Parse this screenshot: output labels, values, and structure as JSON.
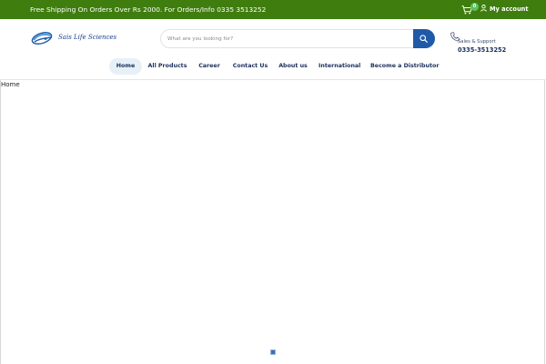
{
  "topbar": {
    "promo_text": "Free Shipping On Orders Over Rs 2000. For Orders/Info 0335 3513252",
    "cart_count": "0",
    "account_label": "My account",
    "background_color": "#3f7d0f"
  },
  "logo": {
    "text": "Sais Life Sciences"
  },
  "search": {
    "placeholder": "What are you looking for?",
    "value": "",
    "button_color": "#1f5aa8"
  },
  "support": {
    "label": "Sales & Support",
    "phone": "0335-3513252"
  },
  "nav": {
    "items": [
      {
        "label": "Home",
        "active": true
      },
      {
        "label": "All Products",
        "active": false
      },
      {
        "label": "Career",
        "active": false
      },
      {
        "label": "Contact Us",
        "active": false
      },
      {
        "label": "About us",
        "active": false
      },
      {
        "label": "International",
        "active": false
      },
      {
        "label": "Become a Distributor",
        "active": false
      }
    ]
  },
  "breadcrumb": {
    "current": "Home"
  },
  "icons": {
    "cart": "cart-icon",
    "account": "user-icon",
    "search": "search-icon",
    "support": "phone-icon",
    "logo": "logo-icon"
  }
}
